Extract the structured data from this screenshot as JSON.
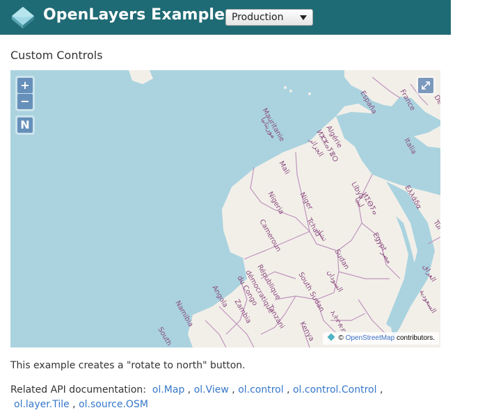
{
  "header": {
    "brand": "OpenLayers Examples",
    "version_select": {
      "value": "Production"
    }
  },
  "page": {
    "title": "Custom Controls",
    "description": "This example creates a \"rotate to north\" button.",
    "related_label": "Related API documentation:",
    "api_links": [
      "ol.Map",
      "ol.View",
      "ol.control",
      "ol.control.Control",
      "ol.layer.Tile",
      "ol.source.OSM"
    ]
  },
  "map": {
    "controls": {
      "zoom_in": "+",
      "zoom_out": "−",
      "rotate_north": "N"
    },
    "attribution": {
      "copyright": "©",
      "link": "OpenStreetMap",
      "suffix": "contributors."
    },
    "labels": {
      "mauritanie": "Mauritanie",
      "mauritanie_ar": "موريتانيا",
      "algerie": "Algérie",
      "algerie_ber": "ⵍⵣⵣⴰⵢⴻⵔ",
      "algerie_ar": "الجزائر",
      "mali": "Mali",
      "niger": "Niger",
      "libya": "Libya",
      "libya_ber": "ⵍⵉⴱⵢⴰ",
      "libya_ar": "ليبيا",
      "nigeria": "Nigeria",
      "cameroun": "Cameroun",
      "tchad": "Tchad",
      "tchad_ar": "تشاد",
      "sudan": "Sudan",
      "sudan_ar": "السودان",
      "egypt": "Egypt",
      "egypt_ar": "مصر",
      "rdc": [
        "République",
        "démocratique",
        "du Congo"
      ],
      "south_sudan": "South Sudan",
      "angola": "Angola",
      "zambia": "Zambia",
      "namibia": "Namibia",
      "tanzania": "Tanzani",
      "kenya": "Kenya",
      "ethiopia": "ኢትዮጵያ",
      "espana": "España",
      "france": "France",
      "italia": "Italia",
      "greece": "Ελλάδα",
      "tur": "Tür",
      "saudi_ar": "السعودية",
      "iraq_ar": "العراق",
      "south": "South",
      "de": "De"
    }
  },
  "colors": {
    "navbar": "#1f6b75",
    "water": "#aad3df",
    "land": "#f2efe9",
    "border": "#b98ab7",
    "label": "#8a4a7e",
    "link": "#3577c9"
  }
}
